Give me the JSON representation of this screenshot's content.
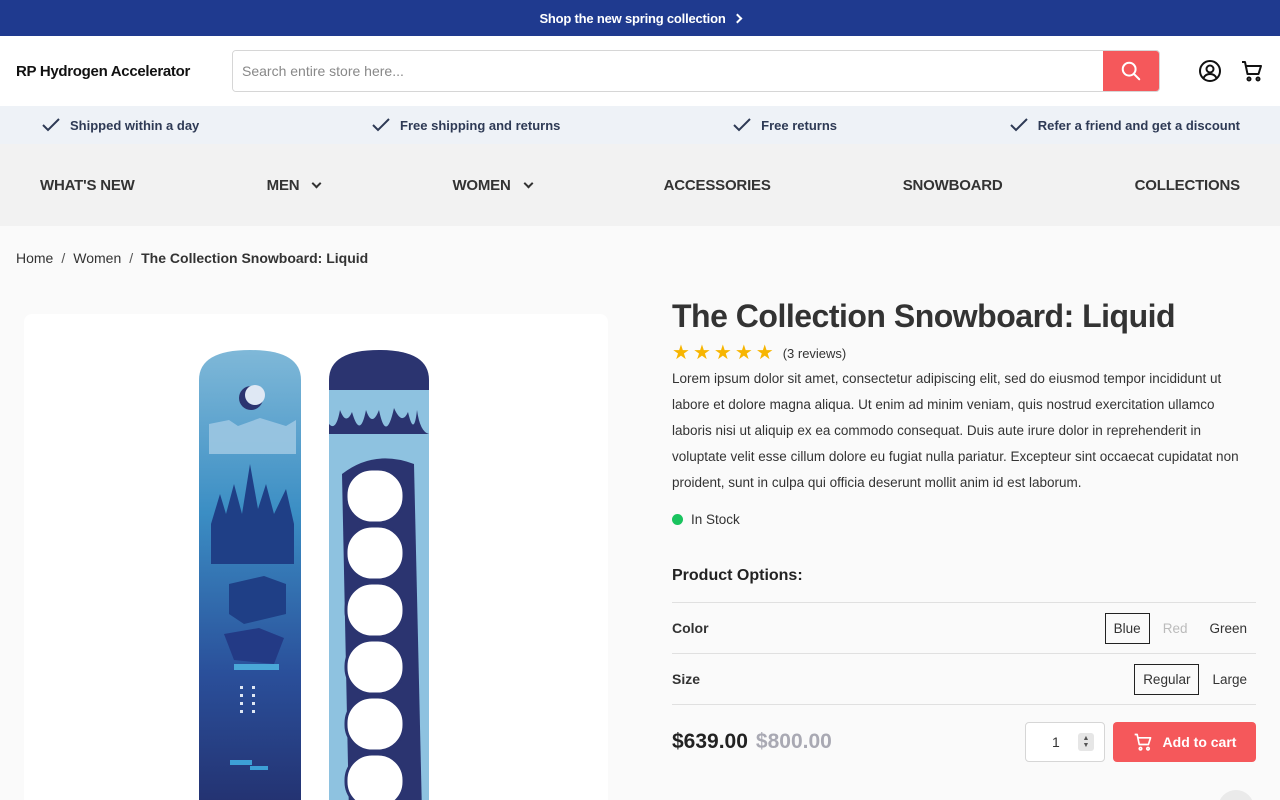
{
  "promo": {
    "text": "Shop the new spring collection",
    "icon": "chevron-right-icon"
  },
  "header": {
    "logo": "RP Hydrogen Accelerator",
    "search_placeholder": "Search entire store here...",
    "search_icon": "search-icon",
    "account_icon": "user-circle-icon",
    "cart_icon": "cart-icon",
    "accent": "#f5585b"
  },
  "usp": [
    {
      "label": "Shipped within a day"
    },
    {
      "label": "Free shipping and returns"
    },
    {
      "label": "Free returns"
    },
    {
      "label": "Refer a friend and get a discount"
    }
  ],
  "nav": [
    {
      "label": "WHAT'S NEW",
      "dropdown": false
    },
    {
      "label": "MEN",
      "dropdown": true
    },
    {
      "label": "WOMEN",
      "dropdown": true
    },
    {
      "label": "ACCESSORIES",
      "dropdown": false
    },
    {
      "label": "SNOWBOARD",
      "dropdown": false
    },
    {
      "label": "COLLECTIONS",
      "dropdown": false
    }
  ],
  "breadcrumb": {
    "home": "Home",
    "category": "Women",
    "current": "The Collection Snowboard: Liquid",
    "separator": "/"
  },
  "product": {
    "title": "The Collection Snowboard: Liquid",
    "rating": 5,
    "reviews": "(3 reviews)",
    "description": "Lorem ipsum dolor sit amet, consectetur adipiscing elit, sed do eiusmod tempor incididunt ut labore et dolore magna aliqua. Ut enim ad minim veniam, quis nostrud exercitation ullamco laboris nisi ut aliquip ex ea commodo consequat. Duis aute irure dolor in reprehenderit in voluptate velit esse cillum dolore eu fugiat nulla pariatur. Excepteur sint occaecat cupidatat non proident, sunt in culpa qui officia deserunt mollit anim id est laborum.",
    "stock": "In Stock",
    "stock_color": "#19c35e",
    "options_title": "Product Options:",
    "options": {
      "color": {
        "label": "Color",
        "values": [
          "Blue",
          "Red",
          "Green"
        ],
        "selected": "Blue",
        "disabled": [
          "Red"
        ]
      },
      "size": {
        "label": "Size",
        "values": [
          "Regular",
          "Large"
        ],
        "selected": "Regular"
      }
    },
    "price": "$639.00",
    "compare_price": "$800.00",
    "quantity": "1",
    "add_to_cart": "Add to cart"
  }
}
